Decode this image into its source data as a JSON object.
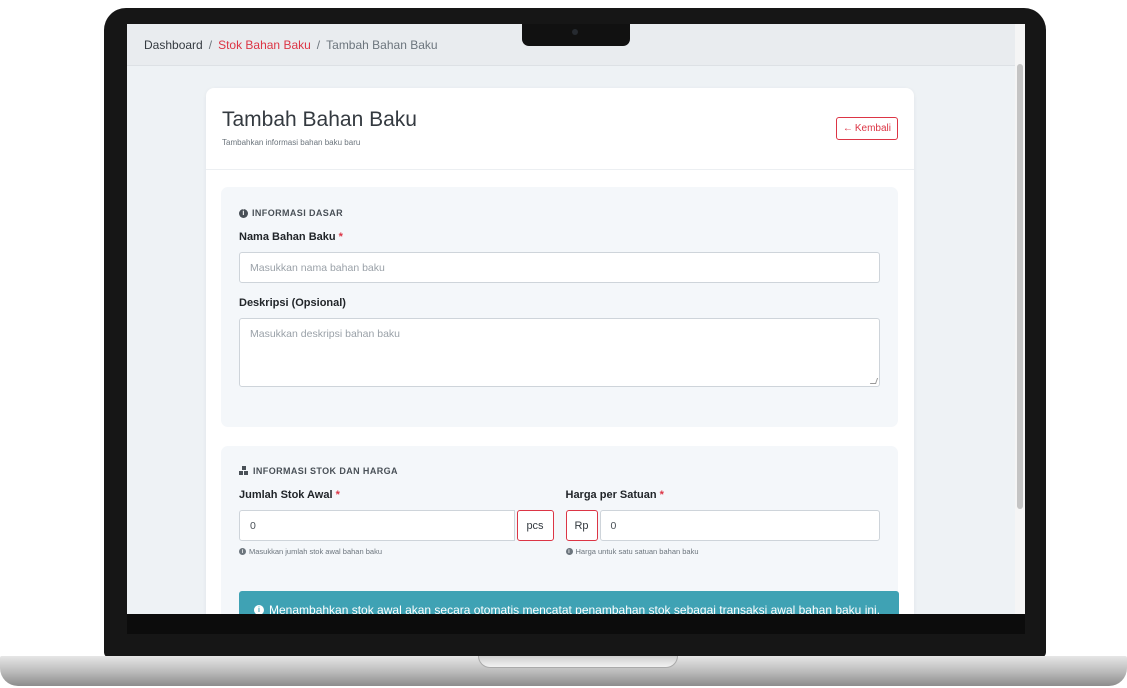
{
  "breadcrumb": {
    "home": "Dashboard",
    "separator": "/",
    "parent": "Stok Bahan Baku",
    "current": "Tambah Bahan Baku"
  },
  "header": {
    "title": "Tambah Bahan Baku",
    "subtitle": "Tambahkan informasi bahan baku baru",
    "back_label": "Kembali"
  },
  "basic_info": {
    "section_title": "INFORMASI DASAR",
    "name_label": "Nama Bahan Baku",
    "name_placeholder": "Masukkan nama bahan baku",
    "desc_label": "Deskripsi (Opsional)",
    "desc_placeholder": "Masukkan deskripsi bahan baku"
  },
  "stock_info": {
    "section_title": "INFORMASI STOK DAN HARGA",
    "stock_label": "Jumlah Stok Awal",
    "stock_value": "0",
    "stock_unit": "pcs",
    "stock_help": "Masukkan jumlah stok awal bahan baku",
    "price_label": "Harga per Satuan",
    "price_prefix": "Rp",
    "price_value": "0",
    "price_help": "Harga untuk satu satuan bahan baku",
    "alert_text": "Menambahkan stok awal akan secara otomatis mencatat penambahan stok sebagai transaksi awal bahan baku ini."
  },
  "required_marker": "*",
  "colors": {
    "accent": "#dc3545",
    "alert": "#3fa2b4",
    "section_bg": "#f4f7fa"
  }
}
